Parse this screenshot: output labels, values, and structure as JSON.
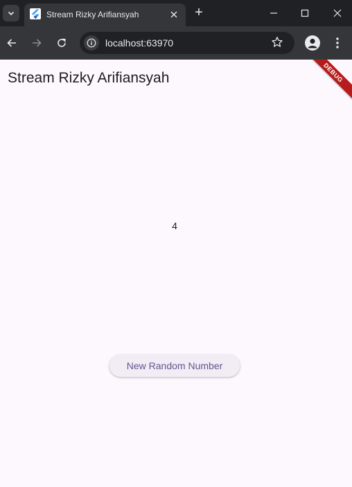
{
  "browser": {
    "tab": {
      "title": "Stream Rizky Arifiansyah",
      "favicon": "flutter-logo-icon"
    },
    "new_tab_symbol": "+",
    "omnibox": {
      "url": "localhost:63970"
    },
    "colors": {
      "frame": "#202124",
      "toolbar": "#35363a",
      "text": "#e8eaed"
    }
  },
  "app": {
    "title": "Stream Rizky Arifiansyah",
    "number_display": "4",
    "button_label": "New Random Number",
    "debug_banner": "DEBUG",
    "colors": {
      "background": "#fdf7fe",
      "button_background": "#f2ecf5",
      "button_text": "#65558f",
      "banner": "#b71c1c"
    }
  }
}
